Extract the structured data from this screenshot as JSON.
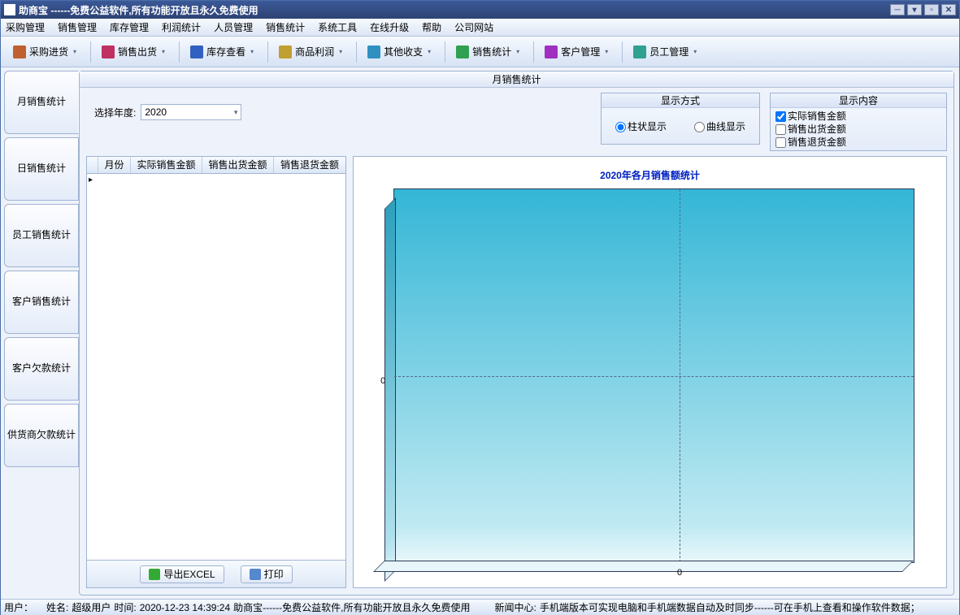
{
  "window": {
    "title": "助商宝 ------免费公益软件,所有功能开放且永久免费使用"
  },
  "menu": [
    "采购管理",
    "销售管理",
    "库存管理",
    "利润统计",
    "人员管理",
    "销售统计",
    "系统工具",
    "在线升级",
    "帮助",
    "公司网站"
  ],
  "toolbar": [
    {
      "label": "采购进货",
      "color": "#c06030"
    },
    {
      "label": "销售出货",
      "color": "#c03060"
    },
    {
      "label": "库存查看",
      "color": "#3060c0"
    },
    {
      "label": "商品利润",
      "color": "#c0a030"
    },
    {
      "label": "其他收支",
      "color": "#3090c0"
    },
    {
      "label": "销售统计",
      "color": "#30a050"
    },
    {
      "label": "客户管理",
      "color": "#a030c0"
    },
    {
      "label": "员工管理",
      "color": "#30a090"
    }
  ],
  "sideTabs": [
    "月销售统计",
    "日销售统计",
    "员工销售统计",
    "客户销售统计",
    "客户欠款统计",
    "供货商欠款统计"
  ],
  "content": {
    "title": "月销售统计",
    "yearLabel": "选择年度:",
    "year": "2020",
    "modePanel": {
      "title": "显示方式",
      "opts": [
        "柱状显示",
        "曲线显示"
      ],
      "selected": 0
    },
    "contentPanel": {
      "title": "显示内容",
      "opts": [
        "实际销售金额",
        "销售出货金额",
        "销售退货金额"
      ],
      "checked": [
        true,
        false,
        false
      ]
    },
    "gridCols": [
      "",
      "月份",
      "实际销售金额",
      "销售出货金额",
      "销售退货金额"
    ],
    "exportBtn": "导出EXCEL",
    "printBtn": "打印"
  },
  "chart_data": {
    "type": "bar",
    "title": "2020年各月销售额统计",
    "categories": [],
    "values": [],
    "xlabel": "",
    "ylabel": "",
    "ylim": [
      0,
      0
    ],
    "axis_zero": "0"
  },
  "status": {
    "userLabel": "用户：",
    "nameLabel": "姓名:",
    "name": "超级用户",
    "timeLabel": "时间:",
    "time": "2020-12-23 14:39:24",
    "app": "助商宝------免费公益软件,所有功能开放且永久免费使用",
    "newsLabel": "新闻中心:",
    "news": "手机端版本可实现电脑和手机端数据自动及时同步------可在手机上查看和操作软件数据；"
  }
}
